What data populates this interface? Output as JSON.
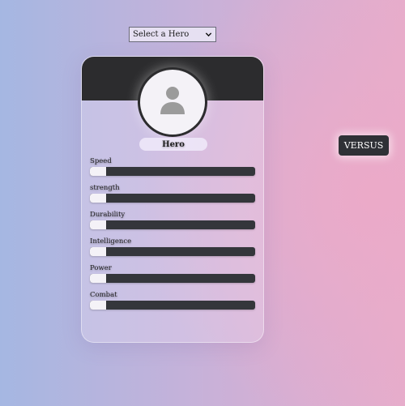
{
  "hero_select": {
    "value": "Select a Hero"
  },
  "card": {
    "hero_name": "Hero",
    "stats": [
      {
        "label": "Speed",
        "value": 0.1
      },
      {
        "label": "strength",
        "value": 0.1
      },
      {
        "label": "Durability",
        "value": 0.1
      },
      {
        "label": "Intelligence",
        "value": 0.1
      },
      {
        "label": "Power",
        "value": 0.1
      },
      {
        "label": "Combat",
        "value": 0.1
      }
    ]
  },
  "versus_button": {
    "label": "VERSUS"
  },
  "colors": {
    "card_header": "#2c2c2e",
    "bar_track": "#34363b",
    "bar_fill": "#f4f2f7",
    "button_bg": "#2f3136",
    "avatar_icon": "#9b9b9b"
  },
  "icons": {
    "avatar": "user-silhouette-icon",
    "select_chevron": "chevron-down-icon"
  }
}
